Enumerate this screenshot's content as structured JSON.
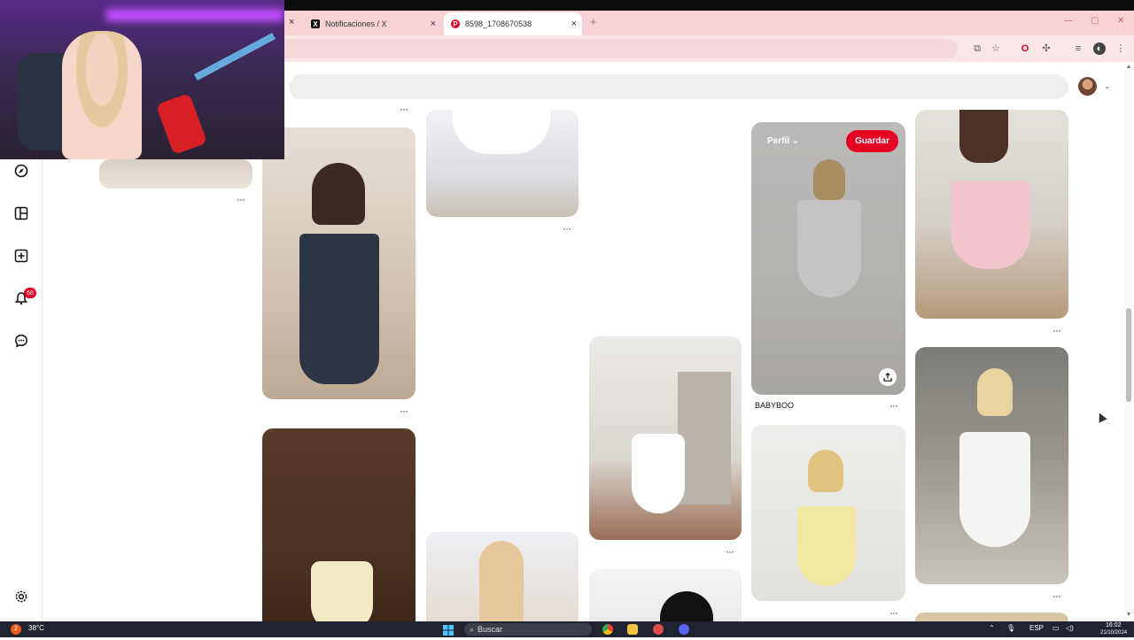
{
  "browser": {
    "tabs": [
      {
        "title": "Notificaciones / X",
        "favicon": "x-logo"
      },
      {
        "title": "8598_1708670538",
        "favicon": "pinterest-logo"
      }
    ],
    "new_tab_symbol": "+",
    "close_symbol": "×"
  },
  "notifications": {
    "badge_count": "68"
  },
  "pins": {
    "hover_pin": {
      "profile_label": "Perfil",
      "save_label": "Guardar",
      "caption": "BABYBOO"
    },
    "more_symbol": "···"
  },
  "taskbar": {
    "weather": "38°C",
    "weather_badge": "2",
    "search_placeholder": "Buscar",
    "language": "ESP",
    "time": "16:02",
    "date": "21/10/2024"
  },
  "colors": {
    "pinterest_red": "#e60023",
    "tab_bar_pink": "#f8d2d4"
  }
}
